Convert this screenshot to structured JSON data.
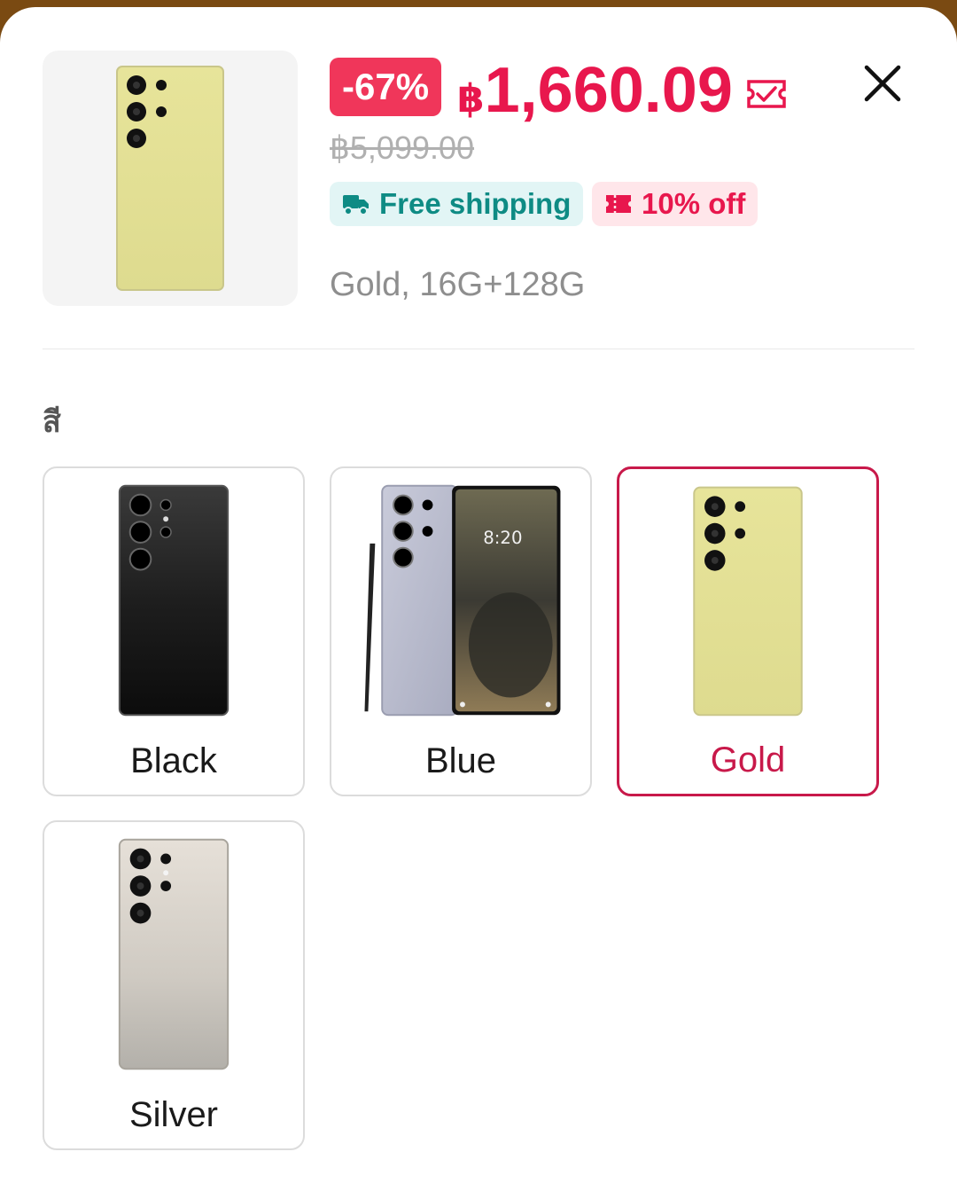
{
  "product": {
    "discount_badge": "-67%",
    "currency_symbol": "฿",
    "price_amount": "1,660.09",
    "original_price": "฿5,099.00",
    "selected_variant": "Gold, 16G+128G"
  },
  "tags": {
    "free_shipping": "Free shipping",
    "percent_off": "10% off"
  },
  "section_label": "สี",
  "options": [
    {
      "label": "Black",
      "selected": false
    },
    {
      "label": "Blue",
      "selected": false
    },
    {
      "label": "Gold",
      "selected": true
    },
    {
      "label": "Silver",
      "selected": false
    }
  ],
  "colors": {
    "accent": "#e8174d",
    "badge": "#f0365a",
    "selected_border": "#c8194a",
    "shipping_tag_bg": "#e2f5f5",
    "shipping_tag_text": "#0e8b84",
    "discount_tag_bg": "#ffe6ea"
  },
  "icons": [
    "voucher-icon",
    "close-icon",
    "truck-icon",
    "coupon-icon"
  ]
}
